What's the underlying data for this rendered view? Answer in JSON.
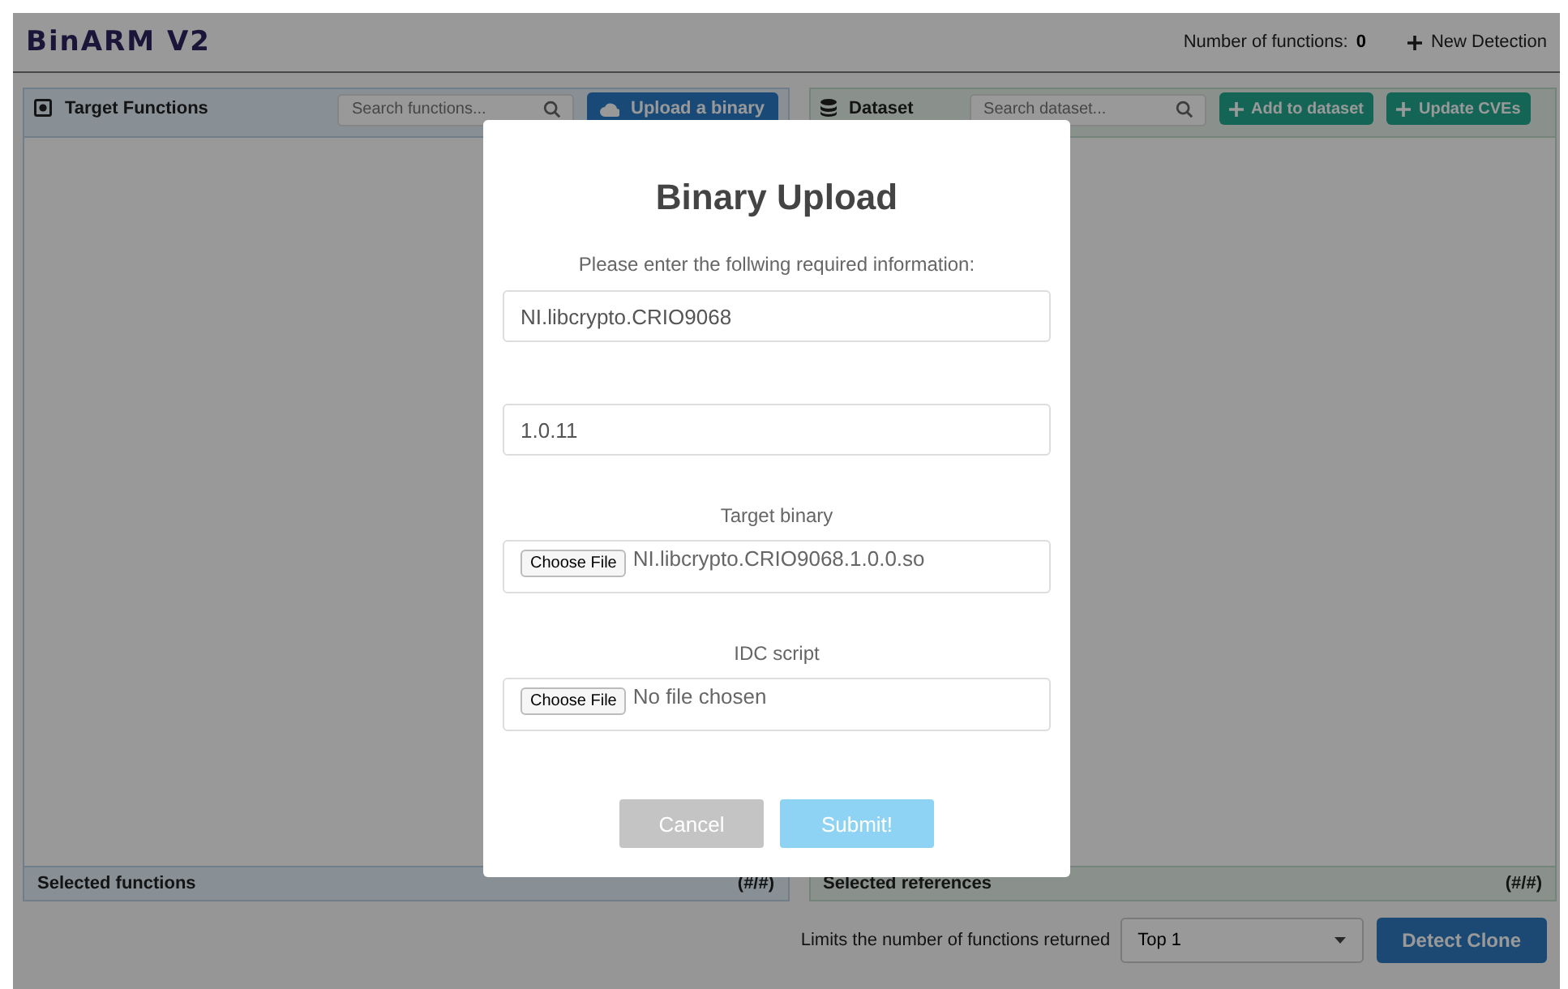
{
  "header": {
    "logo": "BinARM V2",
    "count_label": "Number of functions:",
    "count": "0",
    "new_detection": "New Detection"
  },
  "panels": [
    {
      "kind": "target",
      "title": "Target Functions",
      "search_placeholder": "Search functions...",
      "buttons": [
        "Upload a binary"
      ],
      "footer_label": "Selected functions",
      "footer_count": "(#/#)"
    },
    {
      "kind": "dataset",
      "title": "Dataset",
      "search_placeholder": "Search dataset...",
      "buttons": [
        "Add to dataset",
        "Update CVEs"
      ],
      "footer_label": "Selected references",
      "footer_count": "(#/#)"
    }
  ],
  "bottom": {
    "label": "Limits the number of functions returned",
    "select_value": "Top 1",
    "button": "Detect Clone"
  },
  "modal": {
    "title": "Binary Upload",
    "prompt": "Please enter the follwing required information:",
    "fields": [
      {
        "kind": "text",
        "value": "NI.libcrypto.CRIO9068"
      },
      {
        "kind": "text",
        "value": "1.0.11"
      },
      {
        "kind": "file",
        "label": "Target binary",
        "button": "Choose File",
        "value": "NI.libcrypto.CRIO9068.1.0.0.so"
      },
      {
        "kind": "file",
        "label": "IDC script",
        "button": "Choose File",
        "value": "No file chosen"
      }
    ],
    "buttons": [
      {
        "kind": "cancel",
        "label": "Cancel",
        "disabled": true
      },
      {
        "kind": "submit",
        "label": "Submit!",
        "disabled": true
      }
    ]
  }
}
